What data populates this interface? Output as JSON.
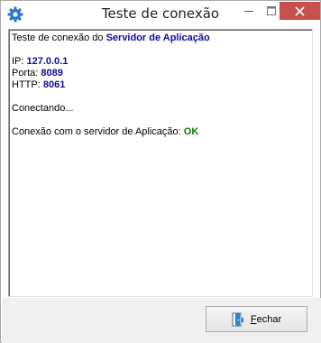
{
  "window": {
    "title": "Teste de conexão",
    "icon": "gear-icon",
    "controls": [
      "minimize-icon",
      "maximize-icon",
      "close-icon"
    ]
  },
  "log": {
    "header_prefix": "Teste de conexão do ",
    "header_highlight": "Servidor de Aplicação",
    "ip_label": "IP: ",
    "ip_value": "127.0.0.1",
    "port_label": "Porta: ",
    "port_value": "8089",
    "http_label": "HTTP: ",
    "http_value": "8061",
    "connecting": "Conectando...",
    "result_label": "Conexão com o servidor de Aplicação: ",
    "result_value": "OK"
  },
  "footer": {
    "close_button_mnemonic": "F",
    "close_button_rest": "echar",
    "close_icon": "door-exit-icon"
  },
  "colors": {
    "highlight_blue": "#0c0c9a",
    "ok_green": "#0a7a0a",
    "close_red": "#c7504c"
  }
}
